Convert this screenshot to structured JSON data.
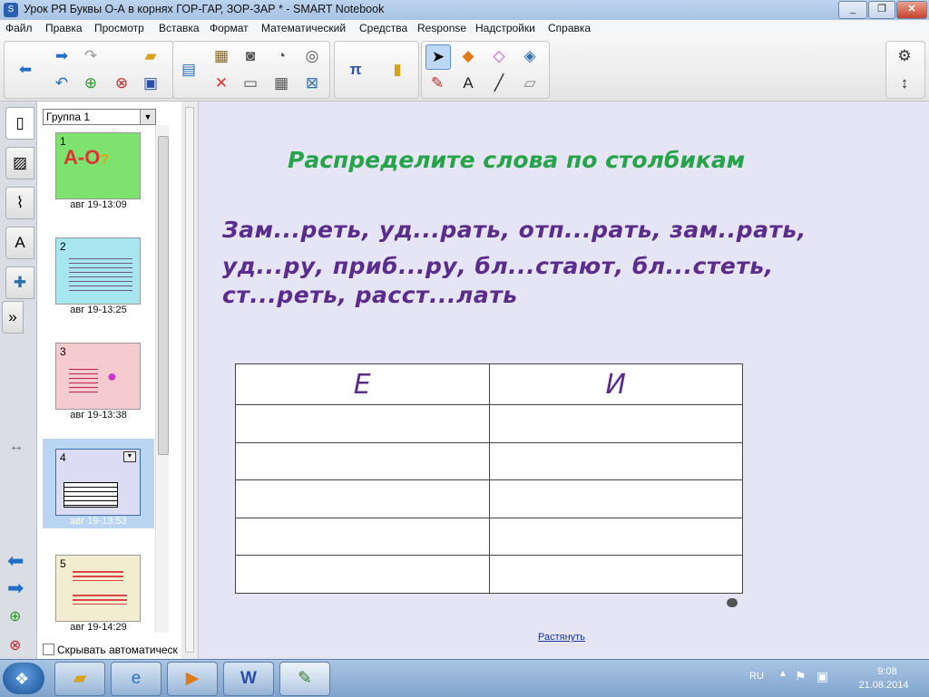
{
  "window": {
    "title": "Урок РЯ Буквы О-А в корнях ГОР-ГАР, ЗОР-ЗАР * - SMART Notebook",
    "app_icon": "smart-notebook-icon",
    "controls": [
      "_",
      "❐",
      "✕"
    ]
  },
  "menu": [
    "Файл",
    "Правка",
    "Просмотр",
    "Вставка",
    "Формат",
    "Математический",
    "Средства",
    "Response",
    "Надстройки",
    "Справка"
  ],
  "toolbar": {
    "icons": [
      "arrow-left-icon",
      "arrow-right-icon",
      "undo-icon",
      "redo-icon",
      "add-page-icon",
      "delete-page-icon",
      "open-icon",
      "save-icon",
      "display-icon",
      "paste-icon",
      "screenshade-icon",
      "capture-icon",
      "document-camera-icon",
      "delete-icon",
      "table-icon",
      "clear-icon",
      "pi-math-icon",
      "gallery-icon",
      "select-icon",
      "shapes-icon",
      "eraser-icon",
      "fill-icon",
      "pens-icon",
      "text-icon",
      "line-icon",
      "magic-eraser-icon",
      "settings-icon",
      "move-toolbar-icon"
    ],
    "accent": "#5b8fc9"
  },
  "sorter": {
    "group": "Группа 1",
    "pages": [
      {
        "num": "1",
        "time": "авг 19-13:09",
        "color": "#7ee26f"
      },
      {
        "num": "2",
        "time": "авг 19-13:25",
        "color": "#a7e6ee"
      },
      {
        "num": "3",
        "time": "авг 19-13:38",
        "color": "#f6cbcf"
      },
      {
        "num": "4",
        "time": "авг 19-13:53",
        "color": "#dcdcf5"
      },
      {
        "num": "5",
        "time": "авг 19-14:29",
        "color": "#f2ecd0"
      }
    ],
    "autohide_label": "Скрывать автоматическ"
  },
  "page": {
    "heading": "Распределите слова по столбикам",
    "word_lines": [
      "Зам...реть,  уд...рать,  отп...рать, зам..рать,",
      "уд...ру,  приб...ру,  бл...стают,  бл...стеть,",
      "ст...реть,  расст...лать"
    ],
    "table": {
      "headers": [
        "Е",
        "И"
      ],
      "empty_rows": 5
    },
    "stretch_link": "Растянуть",
    "heading_color": "#27a34a",
    "words_color": "#5a2c8c"
  },
  "taskbar": {
    "apps": [
      "explorer-icon",
      "internet-explorer-icon",
      "media-player-icon",
      "word-icon",
      "smart-notebook-icon"
    ],
    "language": "RU",
    "time": "9:08",
    "date": "21.08.2014"
  }
}
